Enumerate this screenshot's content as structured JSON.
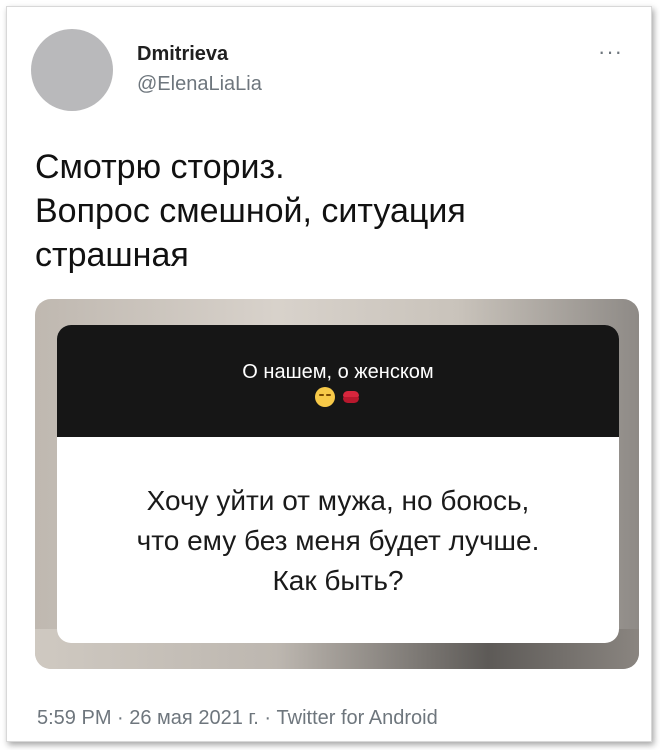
{
  "tweet": {
    "display_name": "Dmitrieva",
    "handle": "@ElenaLiaLia",
    "more_label": "···",
    "text_lines": [
      "Смотрю сториз.",
      "Вопрос смешной, ситуация",
      "страшная"
    ],
    "meta": "5:59 PM · 26 мая 2021 г. · Twitter for Android"
  },
  "story": {
    "question": "О нашем, о женском",
    "emojis": [
      "relieved-face-emoji",
      "kiss-mark-emoji"
    ],
    "answer_lines": [
      "Хочу уйти от мужа, но боюсь,",
      "что ему без меня будет лучше.",
      "Как быть?"
    ]
  }
}
